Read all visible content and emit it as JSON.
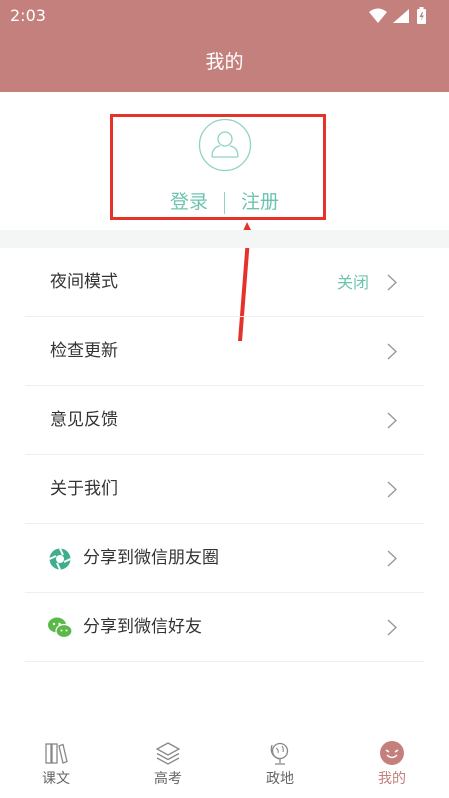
{
  "status_bar": {
    "time": "2:03"
  },
  "header": {
    "title": "我的"
  },
  "profile": {
    "login_label": "登录",
    "register_label": "注册"
  },
  "menu": {
    "items": [
      {
        "label": "夜间模式",
        "value": "关闭"
      },
      {
        "label": "检查更新"
      },
      {
        "label": "意见反馈"
      },
      {
        "label": "关于我们"
      },
      {
        "label": "分享到微信朋友圈",
        "icon": "wechat-moments-icon"
      },
      {
        "label": "分享到微信好友",
        "icon": "wechat-icon"
      }
    ]
  },
  "tabbar": {
    "tabs": [
      {
        "label": "课文",
        "icon": "books-icon"
      },
      {
        "label": "高考",
        "icon": "layers-icon"
      },
      {
        "label": "政地",
        "icon": "globe-icon"
      },
      {
        "label": "我的",
        "icon": "smiley-icon",
        "active": true
      }
    ]
  },
  "colors": {
    "brand": "#c3807d",
    "accent": "#6cc4b0",
    "annotation": "#e5322b"
  }
}
